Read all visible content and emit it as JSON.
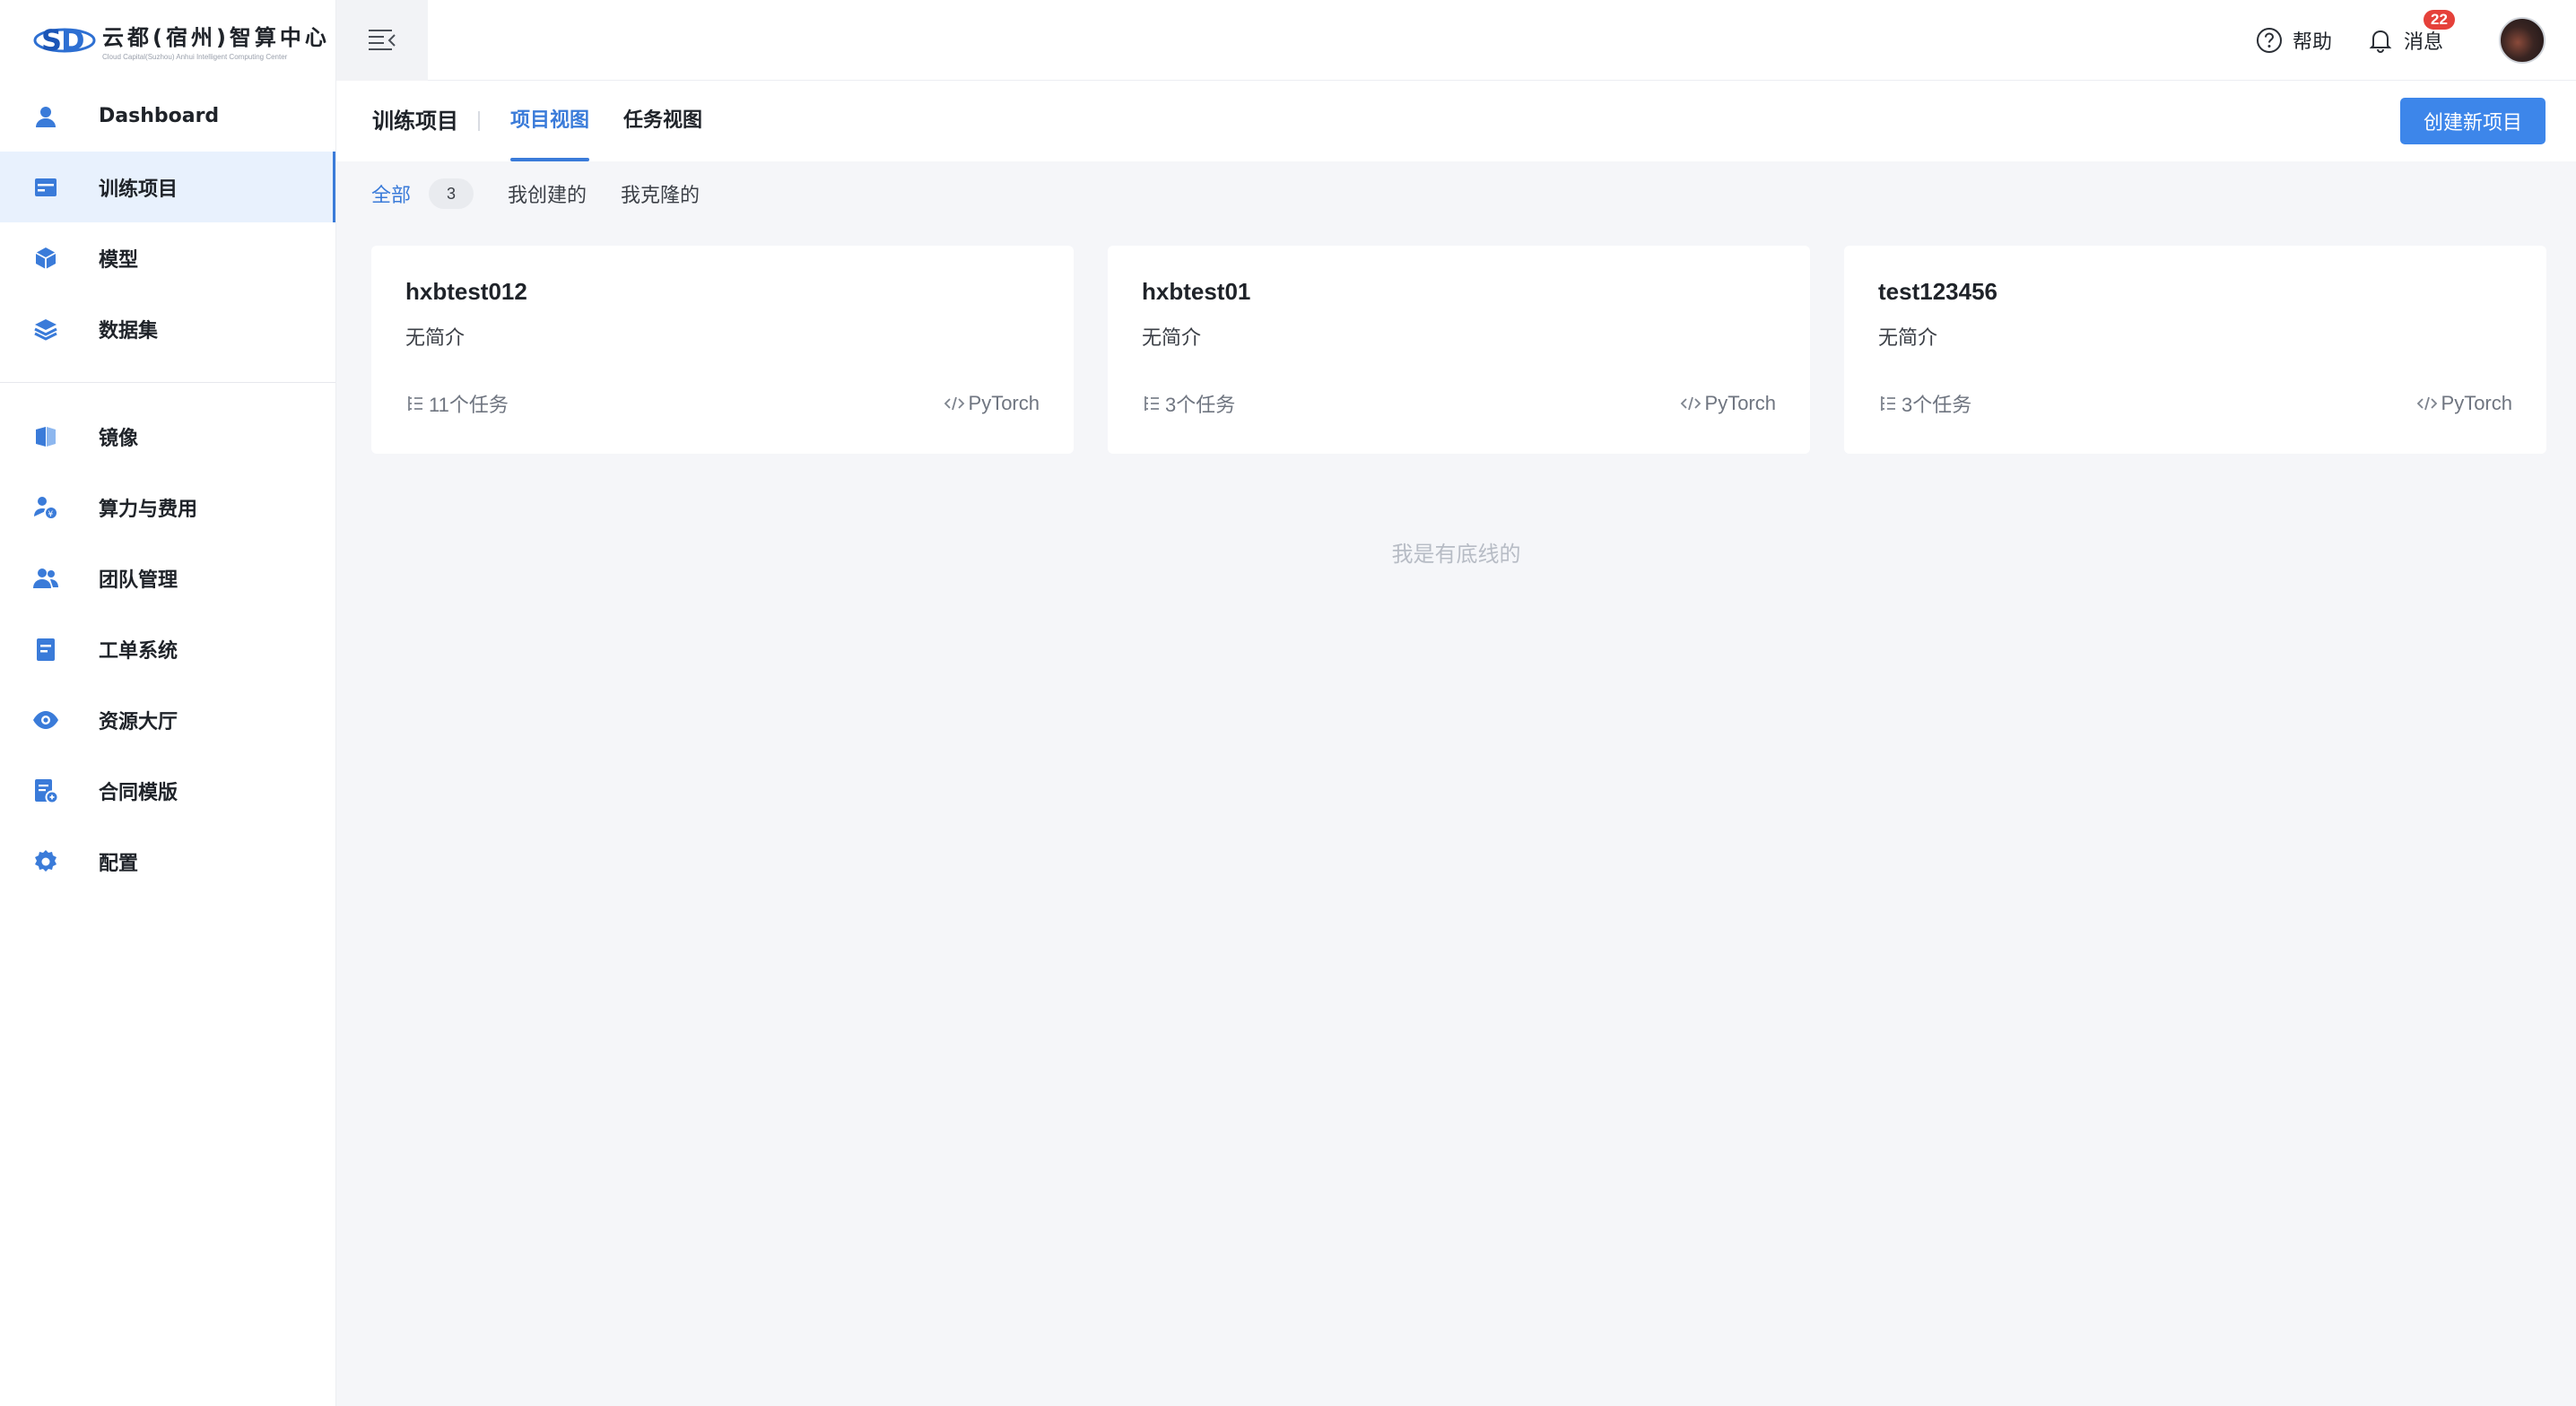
{
  "brand": {
    "title": "云都(宿州)智算中心",
    "subtitle": "Cloud Capital(Suzhou) Anhui Intelligent Computing Center"
  },
  "sidebar": {
    "items": [
      {
        "label": "Dashboard",
        "icon": "user-icon"
      },
      {
        "label": "训练项目",
        "icon": "project-icon",
        "active": true
      },
      {
        "label": "模型",
        "icon": "cube-icon"
      },
      {
        "label": "数据集",
        "icon": "layers-icon"
      },
      {
        "label": "镜像",
        "icon": "image-icon"
      },
      {
        "label": "算力与费用",
        "icon": "compute-cost-icon"
      },
      {
        "label": "团队管理",
        "icon": "team-icon"
      },
      {
        "label": "工单系统",
        "icon": "ticket-icon"
      },
      {
        "label": "资源大厅",
        "icon": "eye-icon"
      },
      {
        "label": "合同模版",
        "icon": "contract-icon"
      },
      {
        "label": "配置",
        "icon": "gear-icon"
      }
    ]
  },
  "topbar": {
    "help_label": "帮助",
    "messages_label": "消息",
    "messages_badge": "22"
  },
  "header": {
    "title": "训练项目",
    "tabs": [
      {
        "label": "项目视图",
        "active": true
      },
      {
        "label": "任务视图",
        "active": false
      }
    ],
    "create_button": "创建新项目"
  },
  "filters": {
    "all_label": "全部",
    "all_count": "3",
    "created_label": "我创建的",
    "cloned_label": "我克隆的"
  },
  "projects": [
    {
      "name": "hxbtest012",
      "desc": "无简介",
      "tasks": "11个任务",
      "framework": "PyTorch"
    },
    {
      "name": "hxbtest01",
      "desc": "无简介",
      "tasks": "3个任务",
      "framework": "PyTorch"
    },
    {
      "name": "test123456",
      "desc": "无简介",
      "tasks": "3个任务",
      "framework": "PyTorch"
    }
  ],
  "footer_note": "我是有底线的",
  "colors": {
    "accent": "#3a7bd9",
    "button": "#3d86ea",
    "badge": "#e5413a",
    "active_bg": "#e8f1fd"
  }
}
